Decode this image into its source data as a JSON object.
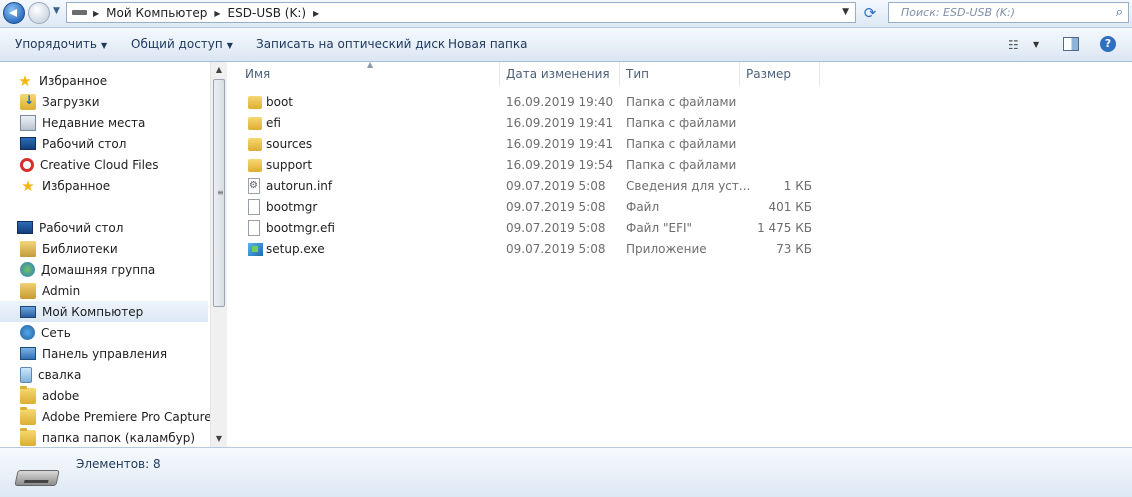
{
  "address_bar": {
    "breadcrumbs": [
      "Мой Компьютер",
      "ESD-USB (K:)"
    ],
    "search_placeholder": "Поиск: ESD-USB (K:)"
  },
  "toolbar": {
    "organize": "Упорядочить",
    "share": "Общий доступ",
    "burn": "Записать на оптический диск",
    "new_folder": "Новая папка"
  },
  "nav": {
    "items": [
      {
        "label": "Избранное",
        "icon": "star-icon"
      },
      {
        "label": "Загрузки",
        "icon": "downloads-folder-icon"
      },
      {
        "label": "Недавние места",
        "icon": "recent-places-icon"
      },
      {
        "label": "Рабочий стол",
        "icon": "desktop-icon"
      },
      {
        "label": "Creative Cloud Files",
        "icon": "creative-cloud-icon"
      },
      {
        "label": "Избранное",
        "icon": "star-icon"
      },
      {
        "label": "Рабочий стол",
        "icon": "desktop-icon"
      },
      {
        "label": "Библиотеки",
        "icon": "libraries-icon"
      },
      {
        "label": "Домашняя группа",
        "icon": "homegroup-icon"
      },
      {
        "label": "Admin",
        "icon": "user-folder-icon"
      },
      {
        "label": "Мой Компьютер",
        "icon": "computer-icon"
      },
      {
        "label": "Сеть",
        "icon": "network-icon"
      },
      {
        "label": "Панель управления",
        "icon": "control-panel-icon"
      },
      {
        "label": "свалка",
        "icon": "recycle-bin-icon"
      },
      {
        "label": "adobe",
        "icon": "folder-icon"
      },
      {
        "label": "Adobe Premiere Pro Captured",
        "icon": "folder-icon"
      },
      {
        "label": "папка папок (каламбур)",
        "icon": "folder-icon"
      }
    ]
  },
  "list": {
    "columns": [
      "Имя",
      "Дата изменения",
      "Тип",
      "Размер"
    ],
    "rows": [
      {
        "name": "boot",
        "date": "16.09.2019 19:40",
        "type": "Папка с файлами",
        "size": "",
        "icon": "folder-icon"
      },
      {
        "name": "efi",
        "date": "16.09.2019 19:41",
        "type": "Папка с файлами",
        "size": "",
        "icon": "folder-icon"
      },
      {
        "name": "sources",
        "date": "16.09.2019 19:41",
        "type": "Папка с файлами",
        "size": "",
        "icon": "folder-icon"
      },
      {
        "name": "support",
        "date": "16.09.2019 19:54",
        "type": "Папка с файлами",
        "size": "",
        "icon": "folder-icon"
      },
      {
        "name": "autorun.inf",
        "date": "09.07.2019 5:08",
        "type": "Сведения для уст...",
        "size": "1 КБ",
        "icon": "inf-file-icon"
      },
      {
        "name": "bootmgr",
        "date": "09.07.2019 5:08",
        "type": "Файл",
        "size": "401 КБ",
        "icon": "file-icon"
      },
      {
        "name": "bootmgr.efi",
        "date": "09.07.2019 5:08",
        "type": "Файл \"EFI\"",
        "size": "1 475 КБ",
        "icon": "file-icon"
      },
      {
        "name": "setup.exe",
        "date": "09.07.2019 5:08",
        "type": "Приложение",
        "size": "73 КБ",
        "icon": "exe-icon"
      }
    ]
  },
  "status": {
    "items_count": "Элементов: 8"
  }
}
